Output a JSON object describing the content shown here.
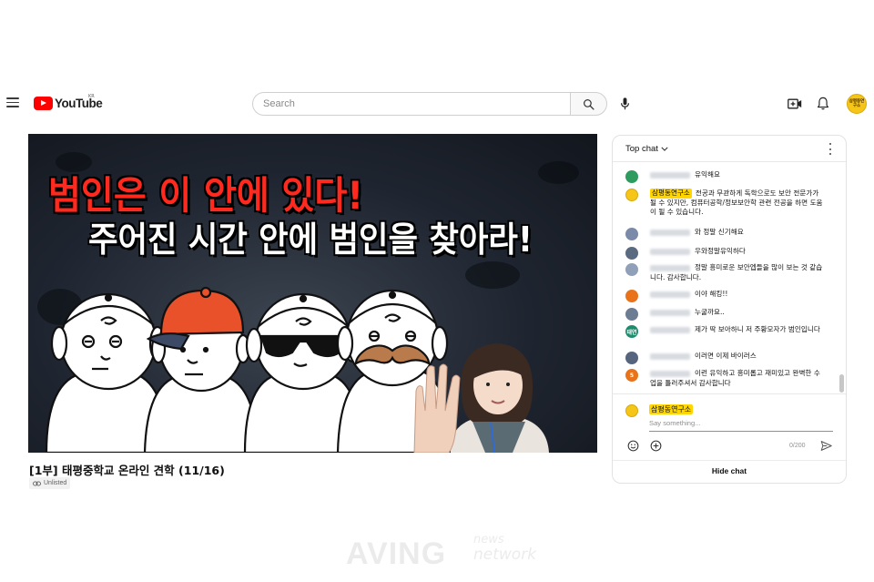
{
  "header": {
    "logo_text": "YouTube",
    "region": "KR",
    "search_placeholder": "Search",
    "avatar_text": "삼평동연구소"
  },
  "video": {
    "title": "[1부] 태평중학교 온라인 견학 (11/16)",
    "visibility": "Unlisted",
    "overlay_line1": "범인은 이 안에 있다!",
    "overlay_line2": "주어진 시간 안에 범인을 찾아라!"
  },
  "chat": {
    "mode_label": "Top chat",
    "messages": [
      {
        "avatar_color": "#2e9c5e",
        "avatar_text": "",
        "author": "",
        "owner": false,
        "text": "유익해요"
      },
      {
        "avatar_color": "#f5c518",
        "avatar_text": "",
        "author": "삼평동연구소",
        "owner": true,
        "text": "전공과 무관하게 독학으로도 보안 전문가가 될 수 있지만, 컴퓨터공학/정보보안학 관련 전공을 하면 도움이 될 수 있습니다."
      },
      {
        "avatar_color": "#7a8aa8",
        "avatar_text": "",
        "author": "",
        "owner": false,
        "text": "와 정말 신기해요"
      },
      {
        "avatar_color": "#5a6a80",
        "avatar_text": "",
        "author": "",
        "owner": false,
        "text": "우와정말유익하다"
      },
      {
        "avatar_color": "#8fa0b8",
        "avatar_text": "",
        "author": "",
        "owner": false,
        "text": "정말 흥미로운 보안엡들을 많이 보는 것 같습니다. 감사합니다."
      },
      {
        "avatar_color": "#e8731a",
        "avatar_text": "",
        "author": "",
        "owner": false,
        "text": "이야 해킹!!"
      },
      {
        "avatar_color": "#6b7c93",
        "avatar_text": "",
        "author": "",
        "owner": false,
        "text": "누굴까요.."
      },
      {
        "avatar_color": "#1e8c6e",
        "avatar_text": "태연",
        "author": "",
        "owner": false,
        "text": "제가 딱 보아하니 저 주황모자가 범인입니다"
      },
      {
        "avatar_color": "#56657d",
        "avatar_text": "",
        "author": "",
        "owner": false,
        "text": "이러면 이제 바이러스"
      },
      {
        "avatar_color": "#e8731a",
        "avatar_text": "5",
        "author": "",
        "owner": false,
        "text": "이런 유익하고 흥미롭고 재미있고 완벽한 수업을 틀러주셔서 감사합니다"
      }
    ],
    "composer": {
      "user_name": "삼평동연구소",
      "placeholder": "Say something...",
      "counter": "0/200"
    },
    "hide_label": "Hide chat"
  },
  "watermark": {
    "main": "AVING",
    "top": "news",
    "bottom": "network"
  },
  "colors": {
    "brand_red": "#ff0000",
    "owner_highlight": "#ffd600",
    "overlay_red": "#ff2a1f"
  }
}
